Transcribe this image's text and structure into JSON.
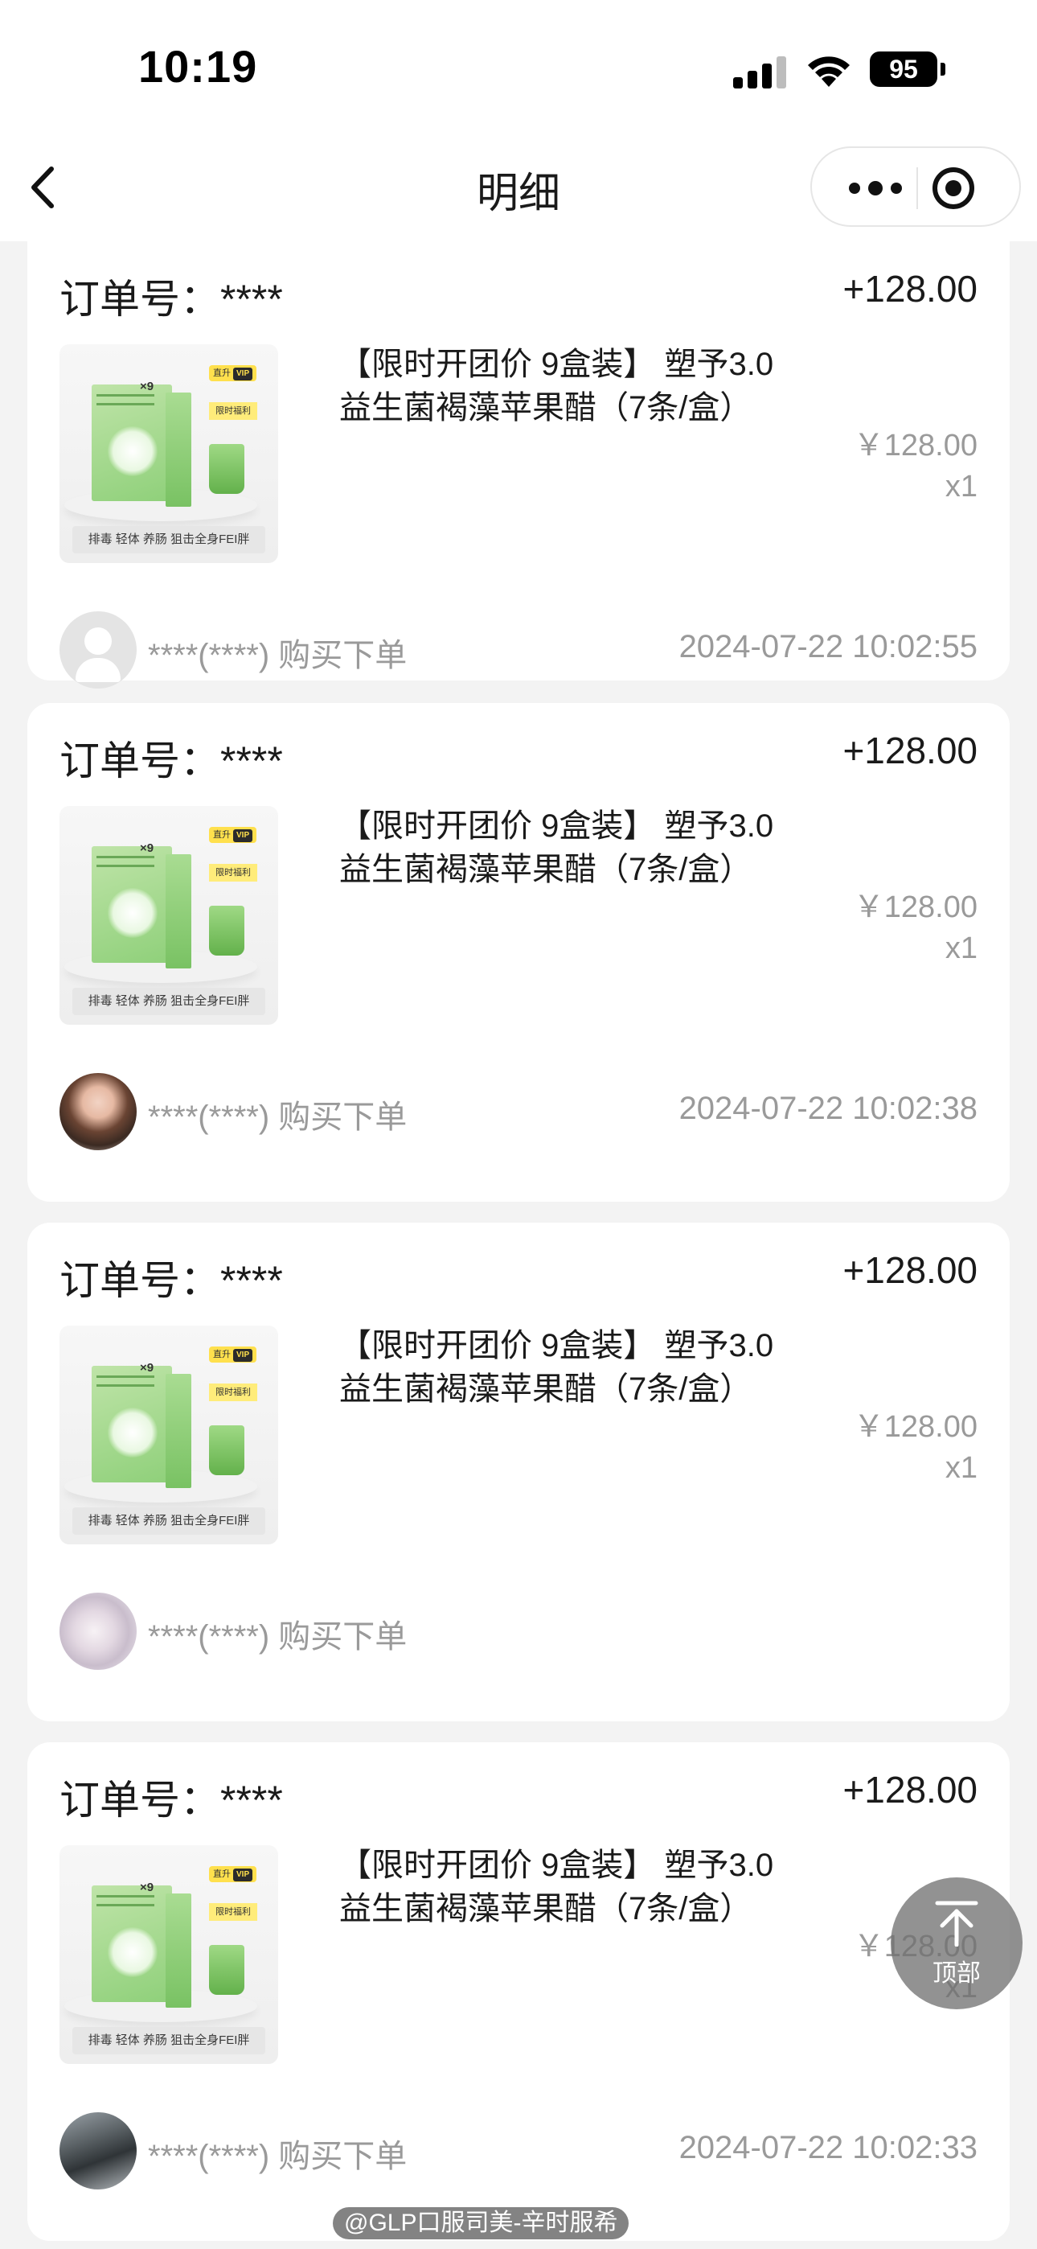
{
  "status_bar": {
    "time": "10:19",
    "battery": "95"
  },
  "nav": {
    "title": "明细"
  },
  "top_button": {
    "label": "顶部"
  },
  "orders": [
    {
      "order_label": "订单号：****",
      "amount": "+128.00",
      "product": {
        "title": "【限时开团价 9盒装】 塑予3.0益生菌褐藻苹果醋（7条/盒）",
        "image_caption": "排毒 轻体 养肠 狙击全身FEI胖",
        "multiplier": "×9",
        "vip_tag": "直升",
        "vip_badge": "VIP",
        "gift_tag": "限时福利"
      },
      "price": "￥128.00",
      "quantity": "x1",
      "buyer": "****(****) 购买下单",
      "time": "2024-07-22 10:02:55"
    },
    {
      "order_label": "订单号：****",
      "amount": "+128.00",
      "product": {
        "title": "【限时开团价 9盒装】 塑予3.0益生菌褐藻苹果醋（7条/盒）",
        "image_caption": "排毒 轻体 养肠 狙击全身FEI胖",
        "multiplier": "×9",
        "vip_tag": "直升",
        "vip_badge": "VIP",
        "gift_tag": "限时福利"
      },
      "price": "￥128.00",
      "quantity": "x1",
      "buyer": "****(****) 购买下单",
      "time": "2024-07-22 10:02:38"
    },
    {
      "order_label": "订单号：****",
      "amount": "+128.00",
      "product": {
        "title": "【限时开团价 9盒装】 塑予3.0益生菌褐藻苹果醋（7条/盒）",
        "image_caption": "排毒 轻体 养肠 狙击全身FEI胖",
        "multiplier": "×9",
        "vip_tag": "直升",
        "vip_badge": "VIP",
        "gift_tag": "限时福利"
      },
      "price": "￥128.00",
      "quantity": "x1",
      "buyer": "****(****) 购买下单",
      "time": ""
    },
    {
      "order_label": "订单号：****",
      "amount": "+128.00",
      "product": {
        "title": "【限时开团价 9盒装】 塑予3.0益生菌褐藻苹果醋（7条/盒）",
        "image_caption": "排毒 轻体 养肠 狙击全身FEI胖",
        "multiplier": "×9",
        "vip_tag": "直升",
        "vip_badge": "VIP",
        "gift_tag": "限时福利"
      },
      "price": "￥128.00",
      "quantity": "x1",
      "buyer": "****(****) 购买下单",
      "time": "2024-07-22 10:02:33"
    }
  ],
  "watermark": "@GLP口服司美-辛时服希",
  "colors": {
    "background": "#f3f3f3",
    "card": "#ffffff",
    "muted_text": "#9a9a9a",
    "top_button": "#6e6e6e"
  }
}
